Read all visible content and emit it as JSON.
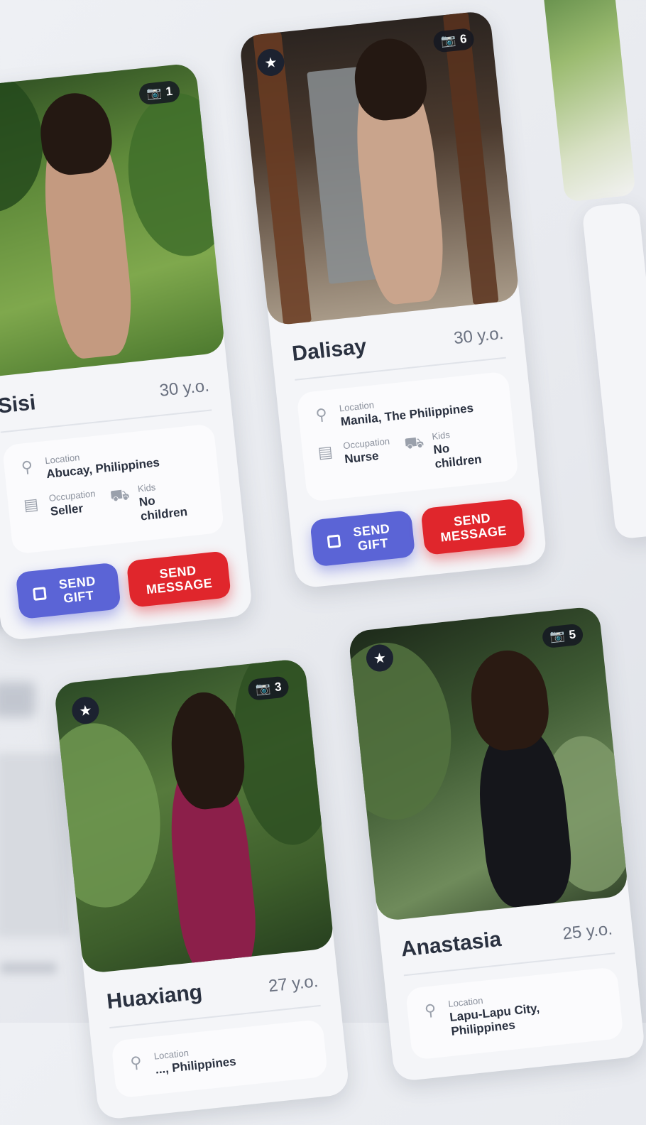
{
  "cards": [
    {
      "name": "Sisi",
      "age": "30 y.o.",
      "photo_count": "1",
      "location_label": "Location",
      "location": "Abucay, Philippines",
      "occupation_label": "Occupation",
      "occupation": "Seller",
      "kids_label": "Kids",
      "kids": "No children",
      "gift_label": "SEND GIFT",
      "message_label": "SEND MESSAGE"
    },
    {
      "name": "Dalisay",
      "age": "30 y.o.",
      "photo_count": "6",
      "location_label": "Location",
      "location": "Manila, The Philippines",
      "occupation_label": "Occupation",
      "occupation": "Nurse",
      "kids_label": "Kids",
      "kids": "No children",
      "gift_label": "SEND GIFT",
      "message_label": "SEND MESSAGE"
    },
    {
      "name": "Huaxiang",
      "age": "27 y.o.",
      "photo_count": "3",
      "location_label": "Location",
      "location": "..., Philippines"
    },
    {
      "name": "Anastasia",
      "age": "25 y.o.",
      "photo_count": "5",
      "location_label": "Location",
      "location": "Lapu-Lapu City, Philippines"
    }
  ],
  "colors": {
    "gift_button": "#5b64d6",
    "message_button": "#e0262c",
    "background_accent": "#ff7a1a"
  },
  "icons": {
    "favorite": "star-icon",
    "photos": "camera-icon",
    "location": "pin-icon",
    "occupation": "briefcase-icon",
    "kids": "stroller-icon",
    "gift": "gift-icon"
  }
}
